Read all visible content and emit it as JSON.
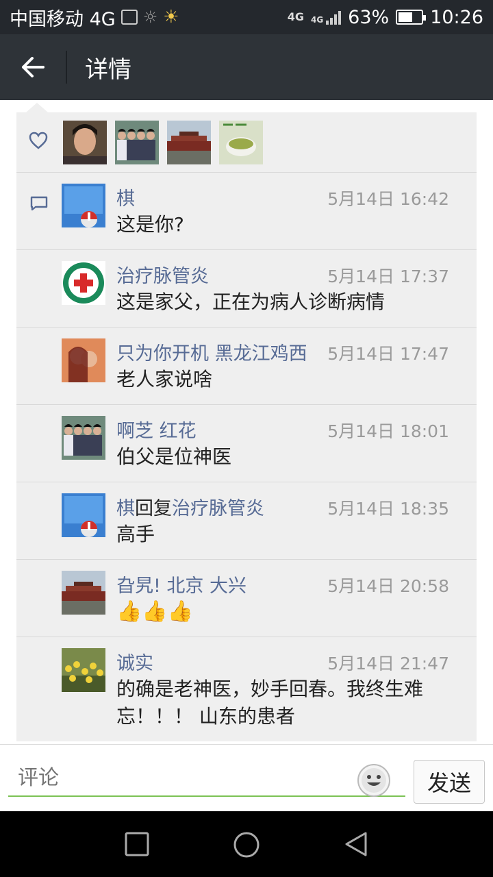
{
  "status_bar": {
    "carrier": "中国移动 4G",
    "network_type_1": "4G",
    "network_type_2": "4G",
    "battery_percent": "63%",
    "battery_level": 0.63,
    "time": "10:26"
  },
  "header": {
    "title": "详情",
    "back_icon": "arrow-left-icon"
  },
  "likes": {
    "icon": "heart-icon",
    "avatars": [
      "avatar-woman-portrait",
      "avatar-group-photo",
      "avatar-tiananmen",
      "avatar-tea-cup"
    ]
  },
  "comments": [
    {
      "name": "棋",
      "reply_word": "",
      "reply_to": "",
      "time": "5月14日 16:42",
      "text": "这是你?",
      "avatar": "avatar-phone-screen",
      "has_icon": true
    },
    {
      "name": "治疗脉管炎",
      "reply_word": "",
      "reply_to": "",
      "time": "5月14日 17:37",
      "text": "这是家父，正在为病人诊断病情",
      "avatar": "avatar-medical-logo",
      "has_icon": false
    },
    {
      "name": "只为你开机  黑龙江鸡西",
      "reply_word": "",
      "reply_to": "",
      "time": "5月14日 17:47",
      "text": "老人家说啥",
      "avatar": "avatar-couple",
      "has_icon": false
    },
    {
      "name": "啊芝   红花",
      "reply_word": "",
      "reply_to": "",
      "time": "5月14日 18:01",
      "text": "伯父是位神医",
      "avatar": "avatar-group-photo",
      "has_icon": false
    },
    {
      "name": "棋",
      "reply_word": "回复",
      "reply_to": "治疗脉管炎",
      "time": "5月14日 18:35",
      "text": "高手",
      "avatar": "avatar-phone-screen",
      "has_icon": false
    },
    {
      "name": "旮旯! 北京 大兴",
      "reply_word": "",
      "reply_to": "",
      "time": "5月14日 20:58",
      "text": "👍👍👍",
      "avatar": "avatar-tiananmen",
      "has_icon": false
    },
    {
      "name": "诚实",
      "reply_word": "",
      "reply_to": "",
      "time": "5月14日 21:47",
      "text": "的确是老神医，妙手回春。我终生难忘！！！ 山东的患者",
      "avatar": "avatar-flowers",
      "has_icon": false
    }
  ],
  "input": {
    "placeholder": "评论",
    "emoji_icon": "smiley-icon",
    "send_label": "发送"
  },
  "nav": {
    "recent_icon": "square-icon",
    "home_icon": "circle-icon",
    "back_icon": "triangle-back-icon"
  }
}
